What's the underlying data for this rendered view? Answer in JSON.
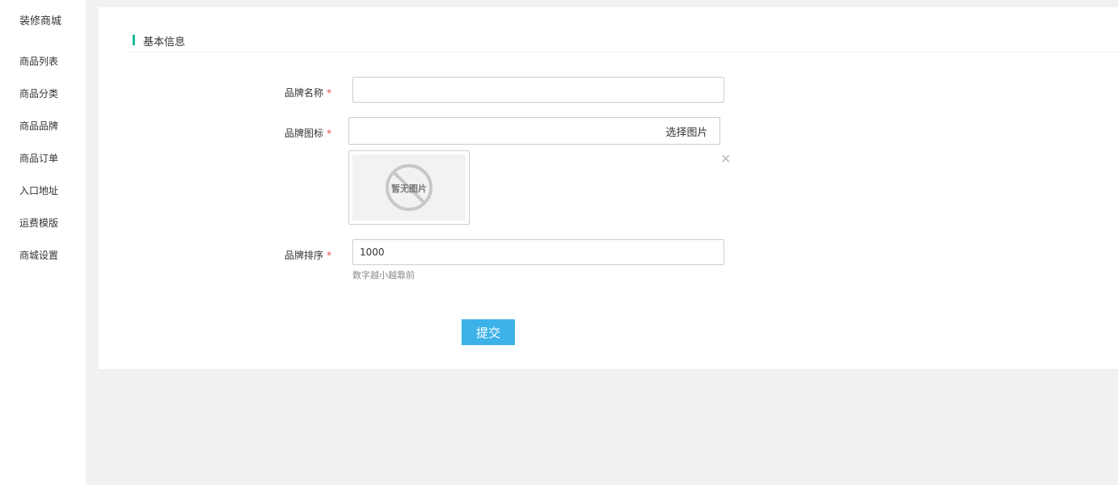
{
  "sidebar": {
    "title": "装修商城",
    "items": [
      {
        "label": "商品列表"
      },
      {
        "label": "商品分类"
      },
      {
        "label": "商品品牌"
      },
      {
        "label": "商品订单"
      },
      {
        "label": "入口地址"
      },
      {
        "label": "运费模版"
      },
      {
        "label": "商城设置"
      }
    ]
  },
  "section": {
    "title": "基本信息",
    "accent_color": "#1bbc9b"
  },
  "form": {
    "brand_name": {
      "label": "品牌名称",
      "required_mark": "*",
      "value": ""
    },
    "brand_icon": {
      "label": "品牌图标",
      "required_mark": "*",
      "value": "",
      "select_label": "选择图片",
      "preview_text": "暂无图片",
      "remove_icon": "close-icon"
    },
    "brand_sort": {
      "label": "品牌排序",
      "required_mark": "*",
      "value": "1000",
      "hint": "数字越小越靠前"
    },
    "submit_label": "提交",
    "submit_color": "#3db2e9"
  }
}
